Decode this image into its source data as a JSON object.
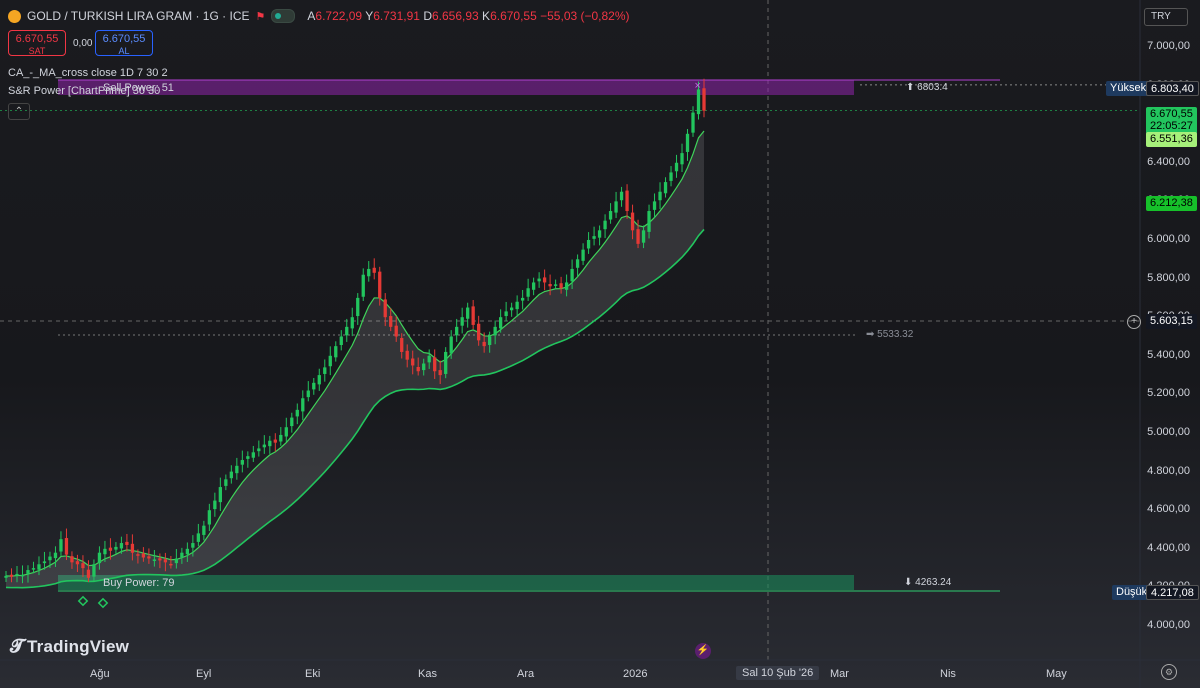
{
  "header": {
    "symbol": "GOLD / TURKISH LIRA GRAM · 1G · ICE",
    "open_label": "A",
    "open": "6.722,09",
    "high_label": "Y",
    "high": "6.731,91",
    "low_label": "D",
    "low": "6.656,93",
    "close_label": "K",
    "close": "6.670,55",
    "change": "−55,03 (−0,82%)"
  },
  "trade": {
    "sell_price": "6.670,55",
    "sell_label": "SAT",
    "spread": "0,00",
    "buy_price": "6.670,55",
    "buy_label": "AL"
  },
  "indicators": {
    "ma": "CA_-_MA_cross close 1D 7 30 2",
    "sr": "S&R Power [ChartPrime] 30 30",
    "sell_power": "Sell Power: 51",
    "buy_power": "Buy Power: 79"
  },
  "currency": "TRY",
  "levels": {
    "high_zone": "⬆ 6803.4",
    "mid_zone": "➡ 5533.32",
    "low_zone": "⬇ 4263.24"
  },
  "price_tags": {
    "yuksek_label": "Yüksek",
    "yuksek_value": "6.803,40",
    "last_price": "6.670,55",
    "countdown": "22:05:27",
    "ma_fast": "6.551,36",
    "ma_slow": "6.212,38",
    "crosshair": "5.603,15",
    "dusuk_label": "Düşük",
    "dusuk_value": "4.217,08"
  },
  "colors": {
    "up": "#22c55e",
    "down": "#e53935",
    "ma_fast": "#b7f0a0",
    "ma_slow": "#22c55e",
    "sell_zone": "#8e24aa",
    "buy_zone": "#1b8a5a",
    "accent": "#f23645"
  },
  "brand": "TradingView",
  "chart_data": {
    "type": "candlestick",
    "title": "GOLD / TURKISH LIRA GRAM · 1G · ICE",
    "ylim": [
      3850,
      7150
    ],
    "y_ticks": [
      "7.000,00",
      "6.800,00",
      "6.600,00",
      "6.400,00",
      "6.200,00",
      "6.000,00",
      "5.800,00",
      "5.600,00",
      "5.400,00",
      "5.200,00",
      "5.000,00",
      "4.800,00",
      "4.600,00",
      "4.400,00",
      "4.200,00",
      "4.000,00"
    ],
    "x_labels": [
      "Ağu",
      "Eyl",
      "Eki",
      "Kas",
      "Ara",
      "2026",
      "Sal 10 Şub '26",
      "Mar",
      "Nis",
      "May"
    ],
    "closes": [
      4260,
      4255,
      4270,
      4265,
      4290,
      4300,
      4320,
      4335,
      4360,
      4380,
      4450,
      4370,
      4330,
      4320,
      4300,
      4250,
      4320,
      4380,
      4400,
      4390,
      4410,
      4430,
      4420,
      4380,
      4370,
      4355,
      4350,
      4345,
      4340,
      4330,
      4320,
      4350,
      4380,
      4400,
      4430,
      4480,
      4520,
      4600,
      4650,
      4720,
      4760,
      4800,
      4830,
      4860,
      4880,
      4900,
      4920,
      4940,
      4960,
      4950,
      4990,
      5030,
      5080,
      5120,
      5180,
      5220,
      5260,
      5300,
      5340,
      5400,
      5450,
      5500,
      5550,
      5600,
      5700,
      5820,
      5850,
      5830,
      5700,
      5600,
      5550,
      5500,
      5420,
      5380,
      5350,
      5320,
      5360,
      5400,
      5320,
      5300,
      5420,
      5500,
      5550,
      5600,
      5650,
      5560,
      5480,
      5450,
      5500,
      5550,
      5600,
      5630,
      5650,
      5680,
      5700,
      5750,
      5780,
      5800,
      5780,
      5760,
      5770,
      5750,
      5780,
      5850,
      5900,
      5950,
      6000,
      6020,
      6050,
      6100,
      6150,
      6200,
      6250,
      6150,
      6050,
      5980,
      6050,
      6150,
      6200,
      6250,
      6300,
      6350,
      6400,
      6450,
      6550,
      6660,
      6780,
      6670
    ],
    "ma_fast_last": 6551.36,
    "ma_slow_last": 6212.38,
    "high": 6803.4,
    "low": 4217.08
  }
}
